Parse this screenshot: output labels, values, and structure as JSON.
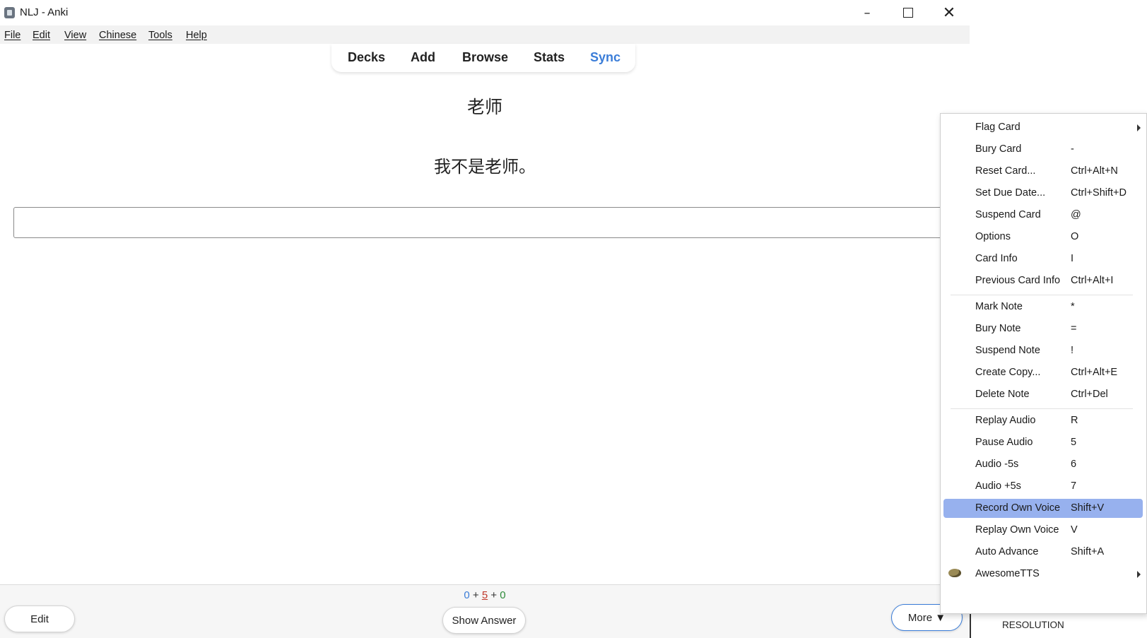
{
  "window": {
    "title": "NLJ - Anki",
    "controls": {
      "minimize": "–",
      "close": "✕"
    }
  },
  "menubar": {
    "items": [
      "File",
      "Edit",
      "View",
      "Chinese",
      "Tools",
      "Help"
    ]
  },
  "toolbar": {
    "items": [
      "Decks",
      "Add",
      "Browse",
      "Stats",
      "Sync"
    ]
  },
  "card": {
    "question": "老师",
    "sentence": "我不是老师。"
  },
  "bottombar": {
    "counts": {
      "new": "0",
      "learn": "5",
      "review": "0",
      "plus": "+"
    },
    "edit_label": "Edit",
    "show_answer_label": "Show Answer",
    "more_label": "More ▼"
  },
  "background": {
    "resolution_label": "RESOLUTION"
  },
  "context_menu": {
    "items": [
      {
        "label": "Flag Card",
        "shortcut": "",
        "submenu": true
      },
      {
        "label": "Bury Card",
        "shortcut": "-"
      },
      {
        "label": "Reset Card...",
        "shortcut": "Ctrl+Alt+N"
      },
      {
        "label": "Set Due Date...",
        "shortcut": "Ctrl+Shift+D"
      },
      {
        "label": "Suspend Card",
        "shortcut": "@"
      },
      {
        "label": "Options",
        "shortcut": "O"
      },
      {
        "label": "Card Info",
        "shortcut": "I"
      },
      {
        "label": "Previous Card Info",
        "shortcut": "Ctrl+Alt+I"
      },
      {
        "label": "Mark Note",
        "shortcut": "*"
      },
      {
        "label": "Bury Note",
        "shortcut": "="
      },
      {
        "label": "Suspend Note",
        "shortcut": "!"
      },
      {
        "label": "Create Copy...",
        "shortcut": "Ctrl+Alt+E"
      },
      {
        "label": "Delete Note",
        "shortcut": "Ctrl+Del"
      },
      {
        "label": "Replay Audio",
        "shortcut": "R"
      },
      {
        "label": "Pause Audio",
        "shortcut": "5"
      },
      {
        "label": "Audio -5s",
        "shortcut": "6"
      },
      {
        "label": "Audio +5s",
        "shortcut": "7"
      },
      {
        "label": "Record Own Voice",
        "shortcut": "Shift+V",
        "highlighted": true
      },
      {
        "label": "Replay Own Voice",
        "shortcut": "V"
      },
      {
        "label": "Auto Advance",
        "shortcut": "Shift+A"
      },
      {
        "label": "AwesomeTTS",
        "shortcut": "",
        "submenu": true,
        "icon": "awesometts-icon"
      }
    ]
  }
}
